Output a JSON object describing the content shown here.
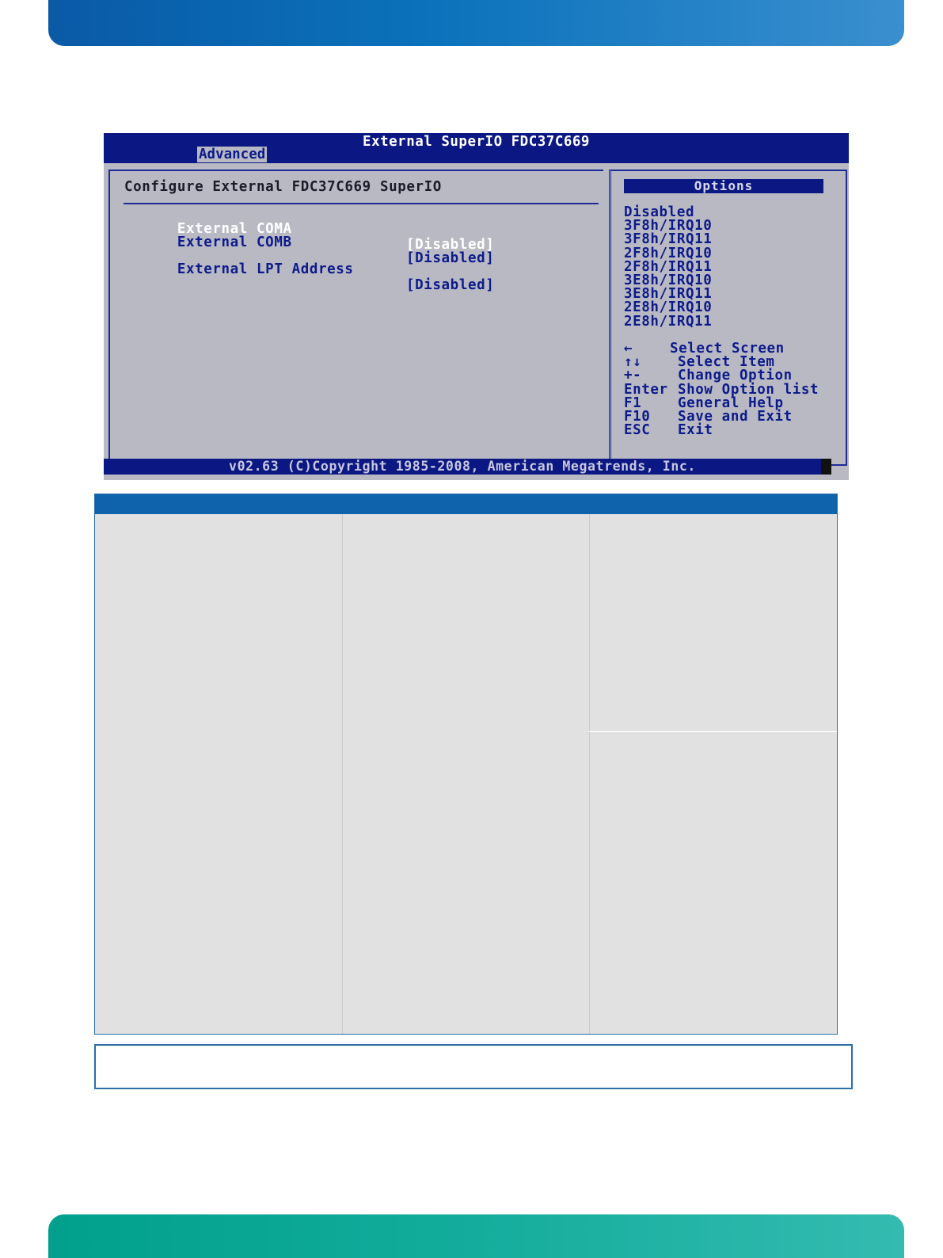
{
  "bios": {
    "title": "External SuperIO FDC37C669",
    "tab": "Advanced",
    "heading": "Configure External FDC37C669 SuperIO",
    "items": [
      {
        "label": "External COMA",
        "value": "[Disabled]"
      },
      {
        "label": "External COMB",
        "value": "[Disabled]"
      },
      {
        "label": "External LPT Address",
        "value": "[Disabled]"
      }
    ],
    "options_title": "Options",
    "options": [
      "Disabled",
      "3F8h/IRQ10",
      "3F8h/IRQ11",
      "2F8h/IRQ10",
      "2F8h/IRQ11",
      "3E8h/IRQ10",
      "3E8h/IRQ11",
      "2E8h/IRQ10",
      "2E8h/IRQ11"
    ],
    "keys": [
      {
        "key": "←",
        "desc": "Select Screen"
      },
      {
        "key": "↑↓",
        "desc": "Select Item"
      },
      {
        "key": "+-",
        "desc": "Change Option"
      },
      {
        "key": "Enter",
        "desc": "Show Option list"
      },
      {
        "key": "F1",
        "desc": "General Help"
      },
      {
        "key": "F10",
        "desc": "Save and Exit"
      },
      {
        "key": "ESC",
        "desc": "Exit"
      }
    ],
    "footer": "v02.63 (C)Copyright 1985-2008, American Megatrends, Inc."
  },
  "colors": {
    "bios_background": "#b9b9c4",
    "bios_blue": "#0b1883",
    "bios_text": "#0c1a8a",
    "header_band": "#0b72bb",
    "footer_band": "#14ad9c",
    "table_header": "#0f63ad"
  }
}
